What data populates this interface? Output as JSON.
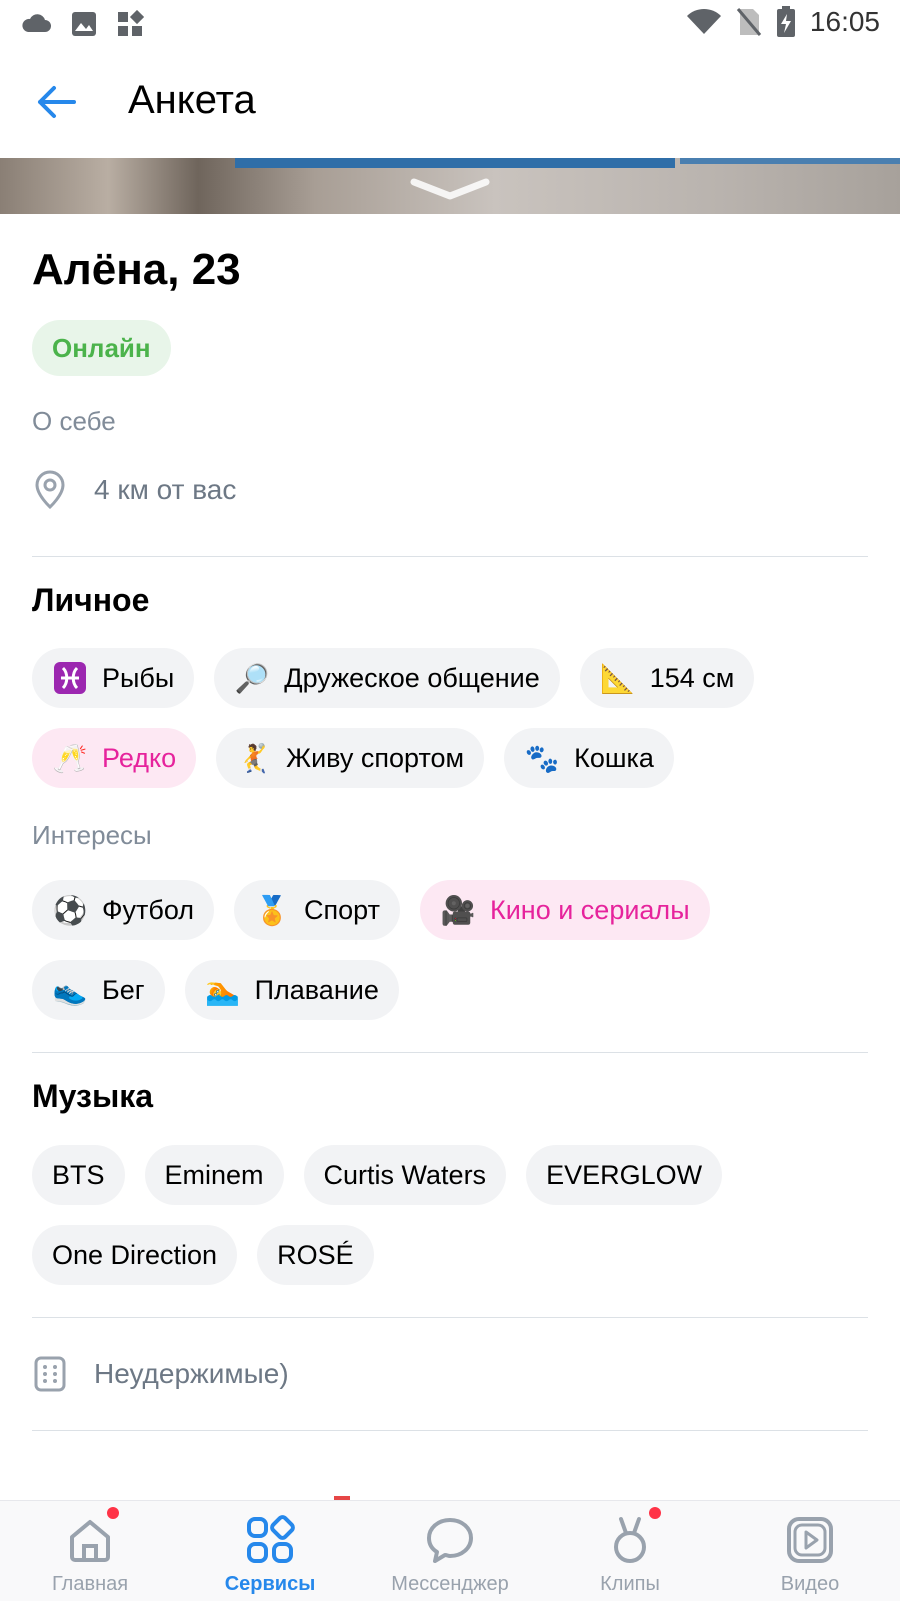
{
  "status_bar": {
    "time": "16:05"
  },
  "header": {
    "title": "Анкета"
  },
  "profile": {
    "name": "Алёна, 23",
    "status": "Онлайн",
    "about_label": "О себе",
    "distance": "4 км от вас"
  },
  "personal": {
    "title": "Личное",
    "chips": [
      {
        "emoji": "♓",
        "label": "Рыбы"
      },
      {
        "emoji": "🔎",
        "label": "Дружеское общение"
      },
      {
        "emoji": "📐",
        "label": "154 см"
      },
      {
        "emoji": "🥂",
        "label": "Редко"
      },
      {
        "emoji": "🤾",
        "label": "Живу спортом"
      },
      {
        "emoji": "🐾",
        "label": "Кошка"
      }
    ]
  },
  "interests": {
    "title": "Интересы",
    "chips": [
      {
        "emoji": "⚽",
        "label": "Футбол"
      },
      {
        "emoji": "🏅",
        "label": "Спорт"
      },
      {
        "emoji": "🎥",
        "label": "Кино и сериалы"
      },
      {
        "emoji": "👟",
        "label": "Бег"
      },
      {
        "emoji": "🏊",
        "label": "Плавание"
      }
    ]
  },
  "music": {
    "title": "Музыка",
    "chips": [
      "BTS",
      "Eminem",
      "Curtis Waters",
      "EVERGLOW",
      "One Direction",
      "ROSÉ"
    ]
  },
  "extra": {
    "text": "Неудержимые)"
  },
  "tabbar": {
    "items": [
      {
        "label": "Главная",
        "icon": "home-icon"
      },
      {
        "label": "Сервисы",
        "icon": "services-icon"
      },
      {
        "label": "Мессенджер",
        "icon": "messenger-icon"
      },
      {
        "label": "Клипы",
        "icon": "clips-icon"
      },
      {
        "label": "Видео",
        "icon": "video-icon"
      }
    ]
  },
  "colors": {
    "accent": "#2688eb",
    "online": "#4bb34b",
    "pink": "#e6239c",
    "badge_dot": "#ff3347"
  }
}
